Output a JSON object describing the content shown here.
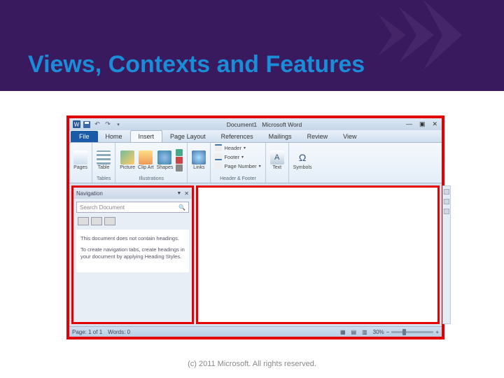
{
  "slide": {
    "title": "Views, Contexts and Features",
    "footer": "(c) 2011 Microsoft. All rights reserved."
  },
  "titlebar": {
    "doc": "Document1",
    "app": "Microsoft Word"
  },
  "tabs": {
    "file": "File",
    "t": [
      "Home",
      "Insert",
      "Page Layout",
      "References",
      "Mailings",
      "Review",
      "View"
    ]
  },
  "ribbon": {
    "pages": {
      "btn": "Pages",
      "label": ""
    },
    "tables": {
      "btn": "Table",
      "label": "Tables"
    },
    "illustrations": {
      "b": [
        "Picture",
        "Clip Art",
        "Shapes"
      ],
      "label": "Illustrations"
    },
    "links": {
      "btn": "Links"
    },
    "hf": {
      "items": [
        "Header",
        "Footer",
        "Page Number"
      ],
      "label": "Header & Footer"
    },
    "text": {
      "btn": "Text"
    },
    "symbols": {
      "btn": "Symbols"
    }
  },
  "nav": {
    "title": "Navigation",
    "search": "Search Document",
    "msg1": "This document does not contain headings.",
    "msg2": "To create navigation tabs, create headings in your document by applying Heading Styles."
  },
  "status": {
    "page": "Page: 1 of 1",
    "words": "Words: 0",
    "zoom": "30%"
  },
  "icons": {
    "search": "🔍",
    "dd": "▾",
    "close": "✕",
    "min": "—",
    "max": "▣"
  }
}
